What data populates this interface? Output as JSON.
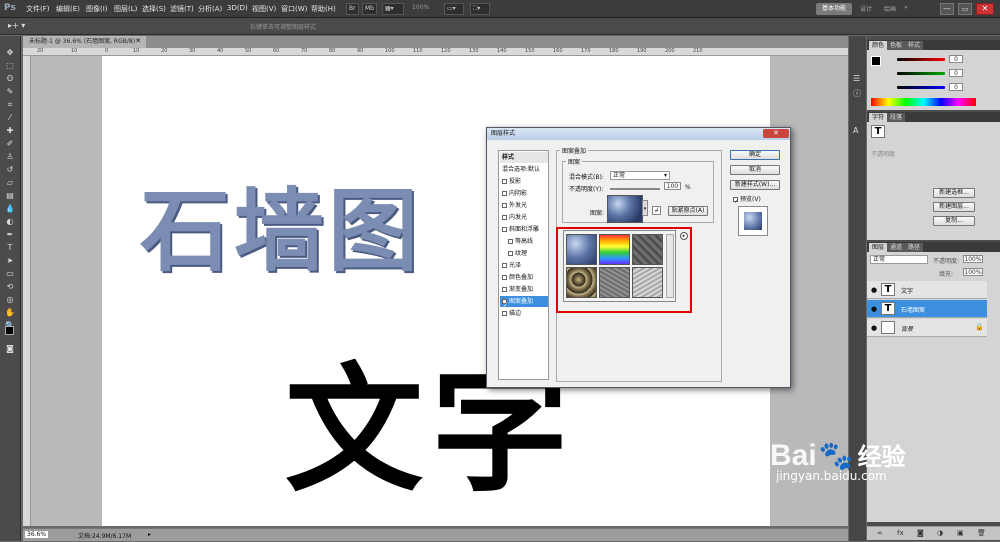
{
  "app": {
    "logo": "Ps"
  },
  "menubar": {
    "items": [
      "文件(F)",
      "编辑(E)",
      "图像(I)",
      "图层(L)",
      "选择(S)",
      "滤镜(T)",
      "分析(A)",
      "3D(D)",
      "视图(V)",
      "窗口(W)",
      "帮助(H)"
    ],
    "zoom": "100%",
    "workspace": "基本功能",
    "ws_links": [
      "设计",
      "绘画"
    ]
  },
  "options": {
    "hint": "右键单击可调整图层样式"
  },
  "document": {
    "tab": "未标题-1 @ 36.6% (石墙图案, RGB/8) *",
    "ruler_ticks": [
      "20",
      "10",
      "0",
      "10",
      "20",
      "30",
      "40",
      "50",
      "60",
      "70",
      "80",
      "90",
      "100",
      "110",
      "120",
      "130",
      "140",
      "150",
      "160",
      "170",
      "180",
      "190",
      "200",
      "210"
    ],
    "text_top": "石墙图",
    "text_bottom": "文字"
  },
  "status": {
    "zoom": "36.6%",
    "doc": "文档:24.9M/6.17M"
  },
  "panels": {
    "color_tabs": [
      "颜色",
      "色板",
      "样式"
    ],
    "color_values": [
      "0",
      "0",
      "0"
    ],
    "char_tabs": [
      "字符",
      "段落"
    ],
    "char_section": "不透明度",
    "layers_tabs": [
      "图层",
      "通道",
      "路径"
    ],
    "blend_mode": "正常",
    "opacity_label": "不透明度:",
    "opacity": "100%",
    "fill_label": "填充:",
    "fill": "100%",
    "layers": [
      {
        "name": "文字",
        "thumb": "T",
        "selected": false
      },
      {
        "name": "石墙图案",
        "thumb": "T",
        "selected": true
      },
      {
        "name": "背景",
        "thumb": "",
        "selected": false
      }
    ],
    "side_buttons": [
      "新建选框...",
      "新建图层...",
      "复制..."
    ]
  },
  "dialog": {
    "title": "图层样式",
    "styles_header": "样式",
    "blend_default": "混合选项:默认",
    "style_items": [
      "投影",
      "内阴影",
      "外发光",
      "内发光",
      "斜面和浮雕",
      "等高线",
      "纹理",
      "光泽",
      "颜色叠加",
      "渐变叠加",
      "图案叠加",
      "描边"
    ],
    "section": "图案叠加",
    "sub_section": "图案",
    "blend_mode_label": "混合模式(B):",
    "blend_mode": "正常",
    "opacity_label": "不透明度(Y):",
    "opacity": "100",
    "opacity_unit": "%",
    "pattern_label": "图案:",
    "snap_button": "贴紧原点(A)",
    "ok": "确定",
    "cancel": "取消",
    "new_style": "新建样式(W)...",
    "preview": "预览(V)"
  },
  "watermark": {
    "brand": "Bai",
    "brand_suffix": "经验",
    "url": "jingyan.baidu.com"
  }
}
